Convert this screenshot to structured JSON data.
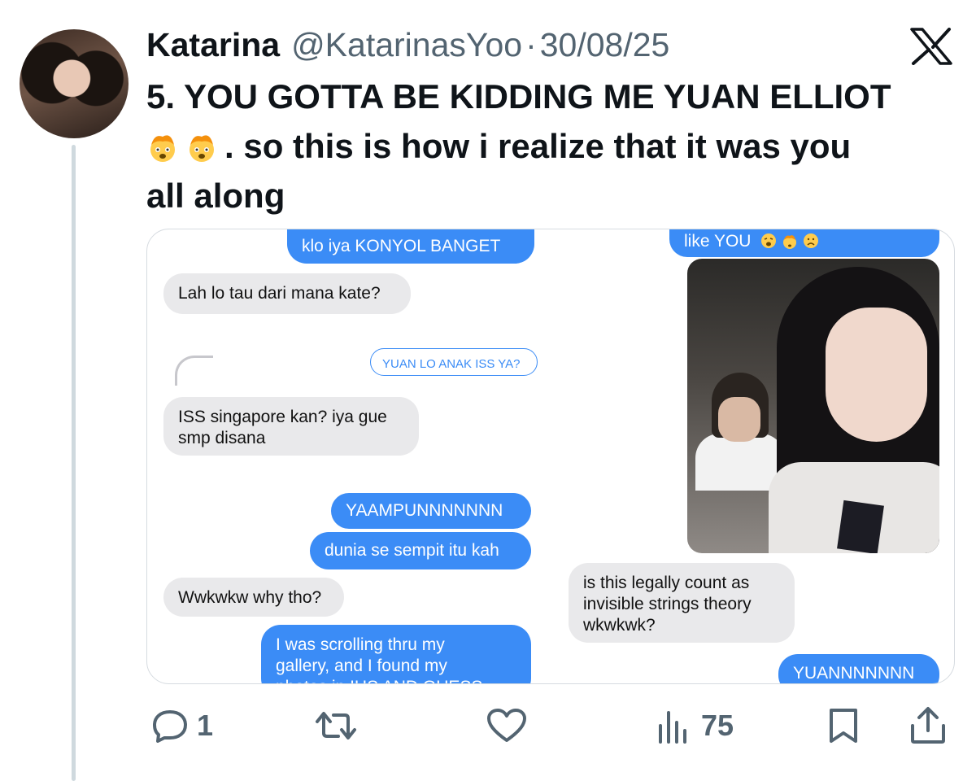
{
  "tweet": {
    "name": "Katarina",
    "handle": "@KatarinasYoo",
    "separator": "·",
    "date": "30/08/25",
    "text_line1": "5. YOU GOTTA BE KIDDING ME YUAN ELLIOT",
    "text_line2_after_emoji": ". so this is how i realize that it was you",
    "text_line3": "all along",
    "emojis": [
      "exploding-head",
      "exploding-head"
    ]
  },
  "chat_left": [
    {
      "type": "sent",
      "text": "klo iya KONYOL BANGET"
    },
    {
      "type": "received",
      "text": "Lah lo tau dari mana kate?"
    },
    {
      "type": "reply-quote",
      "text": "YUAN LO ANAK ISS YA?"
    },
    {
      "type": "received",
      "text_line1": "ISS singapore kan? iya gue",
      "text_line2": "smp disana"
    },
    {
      "type": "sent",
      "text": "YAAMPUNNNNNNN"
    },
    {
      "type": "sent",
      "text": "dunia se sempit itu kah"
    },
    {
      "type": "received",
      "text": "Wwkwkw why tho?"
    },
    {
      "type": "sent",
      "text_line1": "I was scrolling thru my",
      "text_line2": "gallery, and I found my",
      "text_line3": "photos in IHS AND GUESS"
    }
  ],
  "chat_right": [
    {
      "type": "sent",
      "text": "like YOU",
      "emojis": [
        "weary-face",
        "exploding-head",
        "frowning-face"
      ]
    },
    {
      "type": "photo",
      "description_icon": "photo"
    },
    {
      "type": "received",
      "text_line1": "is this legally count as",
      "text_line2": "invisible strings theory",
      "text_line3": "wkwkwk?"
    },
    {
      "type": "sent",
      "text": "YUANNNNNNN"
    }
  ],
  "actions": {
    "replies": "1",
    "reposts": "",
    "likes": "",
    "views": "75",
    "icons": [
      "reply-icon",
      "repost-icon",
      "like-icon",
      "views-icon",
      "bookmark-icon",
      "share-icon"
    ]
  },
  "colors": {
    "imessage_blue": "#3b8cf6",
    "imessage_gray": "#e9e9eb",
    "meta_gray": "#536471",
    "text": "#0f1419"
  }
}
